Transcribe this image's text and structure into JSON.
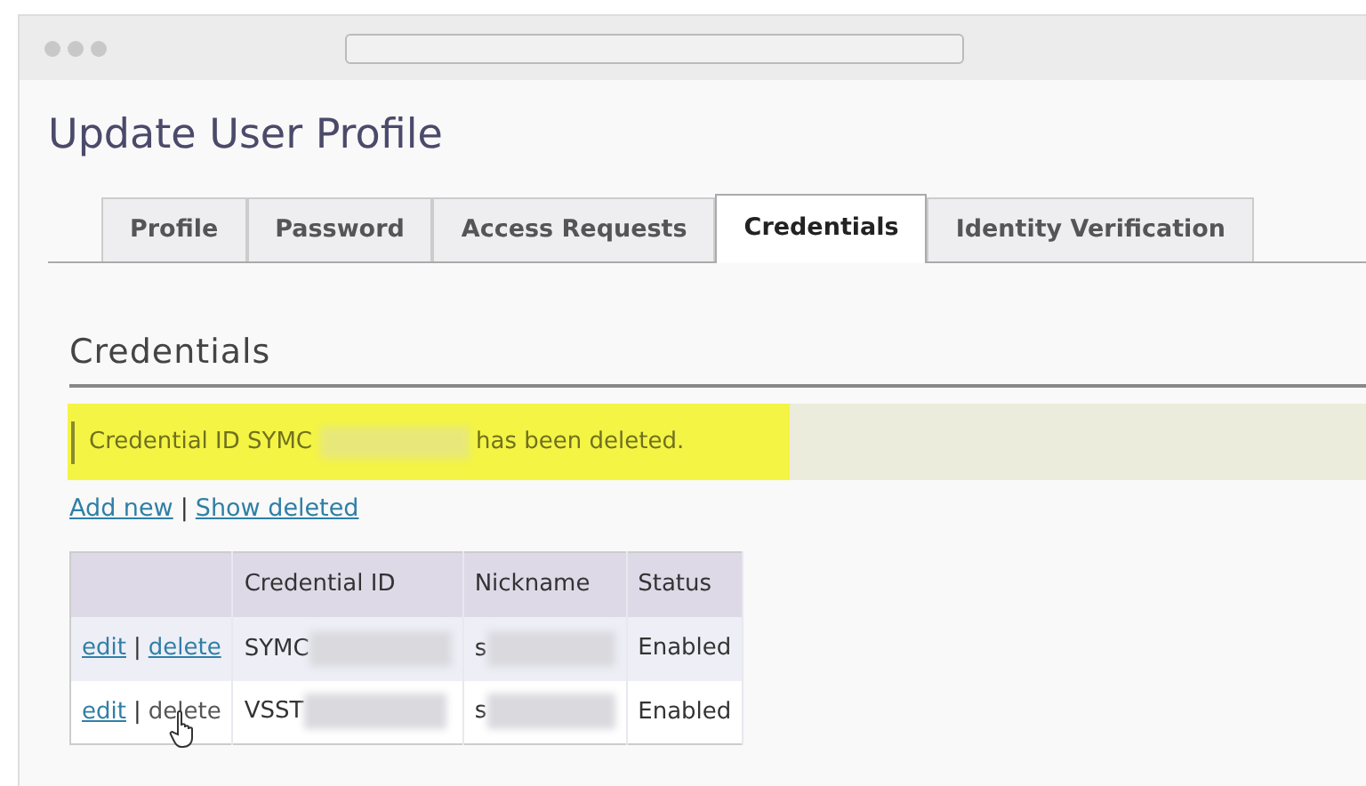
{
  "page": {
    "title": "Update User Profile"
  },
  "tabs": [
    {
      "label": "Profile",
      "selected": false
    },
    {
      "label": "Password",
      "selected": false
    },
    {
      "label": "Access Requests",
      "selected": false
    },
    {
      "label": "Credentials",
      "selected": true
    },
    {
      "label": "Identity Verification",
      "selected": false
    }
  ],
  "section": {
    "heading": "Credentials"
  },
  "message": {
    "prefix": "Credential ID SYMC",
    "suffix": "has been deleted."
  },
  "actions": [
    "Add new",
    "Show deleted"
  ],
  "separator": "|",
  "table": {
    "columns": [
      "",
      "Credential ID",
      "Nickname",
      "Status"
    ],
    "rows": [
      {
        "edit": "edit",
        "separator": "|",
        "delete": "delete",
        "delete_hovered": false,
        "credential_id": "SYMC",
        "nickname": "s",
        "status": "Enabled"
      },
      {
        "edit": "edit",
        "separator": "|",
        "delete": "delete",
        "delete_hovered": true,
        "credential_id": "VSST",
        "nickname": "s",
        "status": "Enabled"
      }
    ]
  }
}
